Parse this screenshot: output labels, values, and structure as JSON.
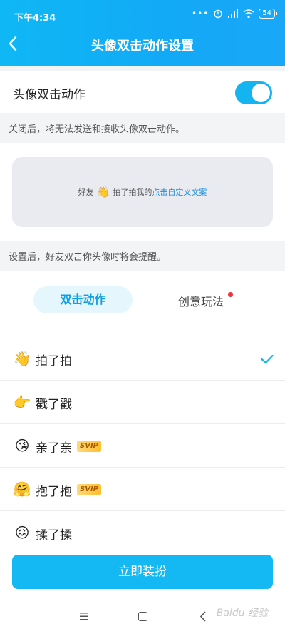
{
  "status_bar": {
    "time": "下午4:34",
    "dots": "•••",
    "battery": "54"
  },
  "header": {
    "title": "头像双击动作设置"
  },
  "toggle_row": {
    "label": "头像双击动作",
    "enabled": true
  },
  "hint_disabled": "关闭后，将无法发送和接收头像双击动作。",
  "preview": {
    "prefix": "好友",
    "action": "拍了拍我的",
    "link": "点击自定义文案"
  },
  "hint_enabled": "设置后，好友双击你头像时将会提醒。",
  "tabs": [
    {
      "label": "双击动作",
      "active": true
    },
    {
      "label": "创意玩法",
      "active": false,
      "has_dot": true
    }
  ],
  "actions": [
    {
      "label": "拍了拍",
      "emoji": "👋",
      "svip": false,
      "selected": true
    },
    {
      "label": "戳了戳",
      "emoji": "👉",
      "svip": false,
      "selected": false
    },
    {
      "label": "亲了亲",
      "emoji": "😘",
      "svip": true,
      "selected": false
    },
    {
      "label": "抱了抱",
      "emoji": "🤗",
      "svip": true,
      "selected": false
    },
    {
      "label": "揉了揉",
      "emoji": "😖",
      "svip": false,
      "selected": false
    }
  ],
  "svip_label": "SVIP",
  "cta_label": "立即装扮",
  "watermark": "Baidu 经验",
  "colors": {
    "accent": "#14b4f0",
    "link": "#1e8fdb",
    "badge_dot": "#ff2e3c"
  }
}
